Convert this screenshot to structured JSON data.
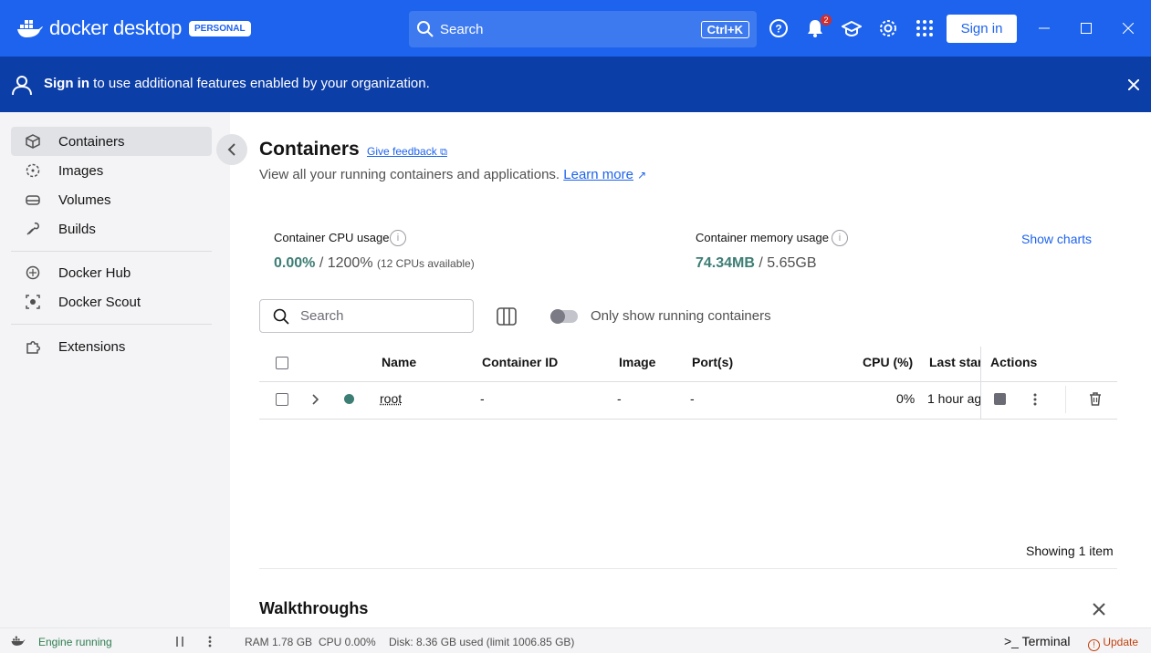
{
  "titlebar": {
    "logo_text": "docker desktop",
    "plan_badge": "PERSONAL",
    "search_label": "Search",
    "search_shortcut": "Ctrl+K",
    "notifications_count": "2",
    "signin_label": "Sign in"
  },
  "banner": {
    "signin_bold": "Sign in",
    "message": "to use additional features enabled by your organization."
  },
  "sidebar": {
    "items": [
      {
        "label": "Containers"
      },
      {
        "label": "Images"
      },
      {
        "label": "Volumes"
      },
      {
        "label": "Builds"
      },
      {
        "label": "Docker Hub"
      },
      {
        "label": "Docker Scout"
      },
      {
        "label": "Extensions"
      }
    ]
  },
  "main": {
    "title": "Containers",
    "feedback_label": "Give feedback",
    "subtitle": "View all your running containers and applications.",
    "learn_more": "Learn more",
    "cpu_label": "Container CPU usage",
    "cpu_used": "0.00%",
    "cpu_total": "/ 1200%",
    "cpu_note": "(12 CPUs available)",
    "mem_label": "Container memory usage",
    "mem_used": "74.34MB",
    "mem_total": "/ 5.65GB",
    "show_charts": "Show charts",
    "search_placeholder": "Search",
    "toggle_label": "Only show running containers",
    "columns": {
      "name": "Name",
      "container_id": "Container ID",
      "image": "Image",
      "ports": "Port(s)",
      "cpu": "CPU (%)",
      "last_started": "Last star",
      "actions": "Actions"
    },
    "rows": [
      {
        "name": "root",
        "container_id": "-",
        "image": "-",
        "ports": "-",
        "cpu": "0%",
        "last_started": "1 hour ag"
      }
    ],
    "showing": "Showing 1 item",
    "walkthroughs": "Walkthroughs"
  },
  "statusbar": {
    "engine": "Engine running",
    "ram": "RAM 1.78 GB",
    "cpu": "CPU 0.00%",
    "disk": "Disk: 8.36 GB used (limit 1006.85 GB)",
    "terminal": "Terminal",
    "update": "Update"
  },
  "colors": {
    "brand": "#1d63ed",
    "banner": "#0c3ea8",
    "running": "#3c7d74",
    "update": "#c2410c"
  }
}
